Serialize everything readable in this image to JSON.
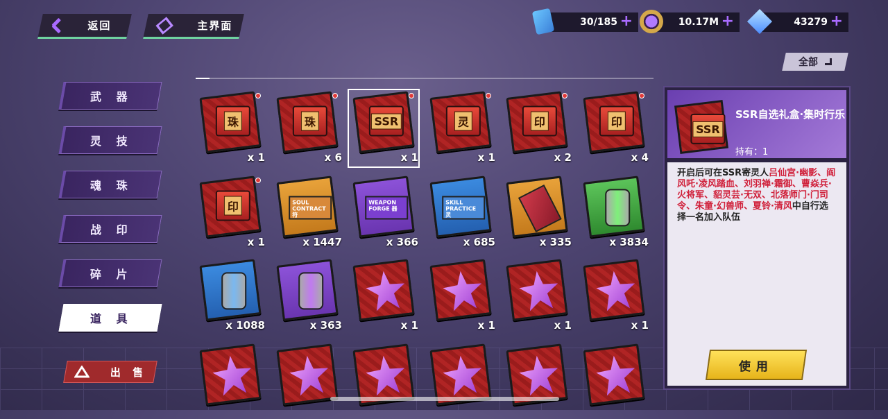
{
  "header": {
    "back_label": "返回",
    "home_label": "主界面"
  },
  "resources": [
    {
      "icon": "stamina-card-icon",
      "value": "30/185"
    },
    {
      "icon": "coin-icon",
      "value": "10.17M"
    },
    {
      "icon": "diamond-icon",
      "value": "43279"
    }
  ],
  "filter": {
    "label": "全部"
  },
  "categories": [
    "武 器",
    "灵 技",
    "魂 珠",
    "战 印",
    "碎 片",
    "道 具"
  ],
  "active_category": "道 具",
  "sell_label": "出 售",
  "items": [
    {
      "type": "box",
      "tag": "珠",
      "qty": "x 1",
      "new": true
    },
    {
      "type": "box",
      "tag": "珠",
      "qty": "x 6",
      "new": true
    },
    {
      "type": "box",
      "tag": "SSR",
      "qty": "x 1",
      "new": true,
      "selected": true
    },
    {
      "type": "box",
      "tag": "灵",
      "qty": "x 1",
      "new": true
    },
    {
      "type": "box",
      "tag": "印",
      "qty": "x 2",
      "new": true
    },
    {
      "type": "box",
      "tag": "印",
      "qty": "x 4",
      "new": true
    },
    {
      "type": "box",
      "tag": "印",
      "qty": "x 1",
      "new": true
    },
    {
      "type": "ticket",
      "tag": "SOUL CONTRACT 符",
      "qty": "x 1447"
    },
    {
      "type": "ticket",
      "tag": "WEAPON FORGE 器",
      "qty": "x 366"
    },
    {
      "type": "ticket",
      "tag": "SKILL PRACTICE 灵",
      "qty": "x 685"
    },
    {
      "type": "book",
      "qty": "x 335"
    },
    {
      "type": "can-green",
      "qty": "x 3834"
    },
    {
      "type": "can-blue",
      "qty": "x 1088"
    },
    {
      "type": "can-purple",
      "qty": "x 363"
    },
    {
      "type": "star",
      "qty": "x 1"
    },
    {
      "type": "star",
      "qty": "x 1"
    },
    {
      "type": "star",
      "qty": "x 1"
    },
    {
      "type": "star",
      "qty": "x 1"
    },
    {
      "type": "star",
      "qty": ""
    },
    {
      "type": "star",
      "qty": ""
    },
    {
      "type": "star",
      "qty": ""
    },
    {
      "type": "star",
      "qty": ""
    },
    {
      "type": "star",
      "qty": ""
    },
    {
      "type": "star",
      "qty": ""
    }
  ],
  "detail": {
    "name": "SSR自选礼盒·集时行乐",
    "owned": "持有：1",
    "desc_prefix": "开启后可在SSR寄灵人",
    "desc_highlight": "吕仙宫·幽影、阎风吒·凌风踏血、刘羽禅·霜御、曹焱兵·火将军、貂灵芸·无双、北落师门·门司令、朱童·幻兽师、夏铃·清风",
    "desc_suffix": "中自行选择一名加入队伍",
    "use_label": "使用"
  }
}
